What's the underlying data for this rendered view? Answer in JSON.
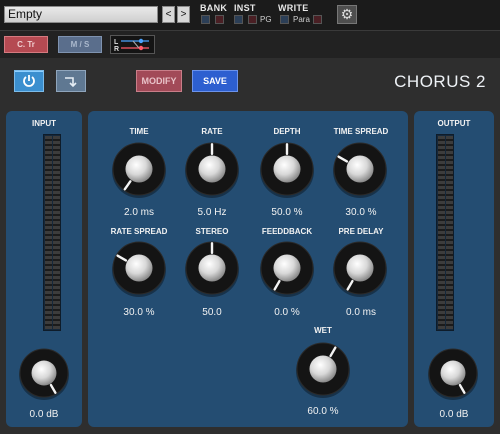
{
  "header": {
    "preset_name": "Empty",
    "prev_label": "<",
    "next_label": ">",
    "bank_label": "BANK",
    "inst_label": "INST",
    "pg_label": "PG",
    "write_label": "WRITE",
    "para_label": "Para"
  },
  "toolbar": {
    "ctr_label": "C. Tr",
    "ms_label": "M / S",
    "l_label": "L",
    "r_label": "R"
  },
  "plugin": {
    "title": "CHORUS 2",
    "modify_label": "MODIFY",
    "save_label": "SAVE"
  },
  "input": {
    "label": "INPUT",
    "value": "0.0 dB",
    "level": 0.0
  },
  "output": {
    "label": "OUTPUT",
    "value": "0.0 dB",
    "level": 0.0
  },
  "params": [
    {
      "label": "TIME",
      "value": "2.0 ms"
    },
    {
      "label": "RATE",
      "value": "5.0 Hz"
    },
    {
      "label": "DEPTH",
      "value": "50.0 %"
    },
    {
      "label": "TIME SPREAD",
      "value": "30.0 %"
    },
    {
      "label": "RATE SPREAD",
      "value": "30.0 %"
    },
    {
      "label": "STEREO",
      "value": "50.0"
    },
    {
      "label": "FEEDDBACK",
      "value": "0.0 %"
    },
    {
      "label": "PRE DELAY",
      "value": "0.0 ms"
    },
    {
      "label": "WET",
      "value": "60.0 %"
    }
  ],
  "colors": {
    "panel_blue": "#244d72",
    "power_blue": "#3b8fcf",
    "save_blue": "#2d5fd0",
    "modify_red": "#a24a58",
    "ctr_red": "#b54a52"
  }
}
